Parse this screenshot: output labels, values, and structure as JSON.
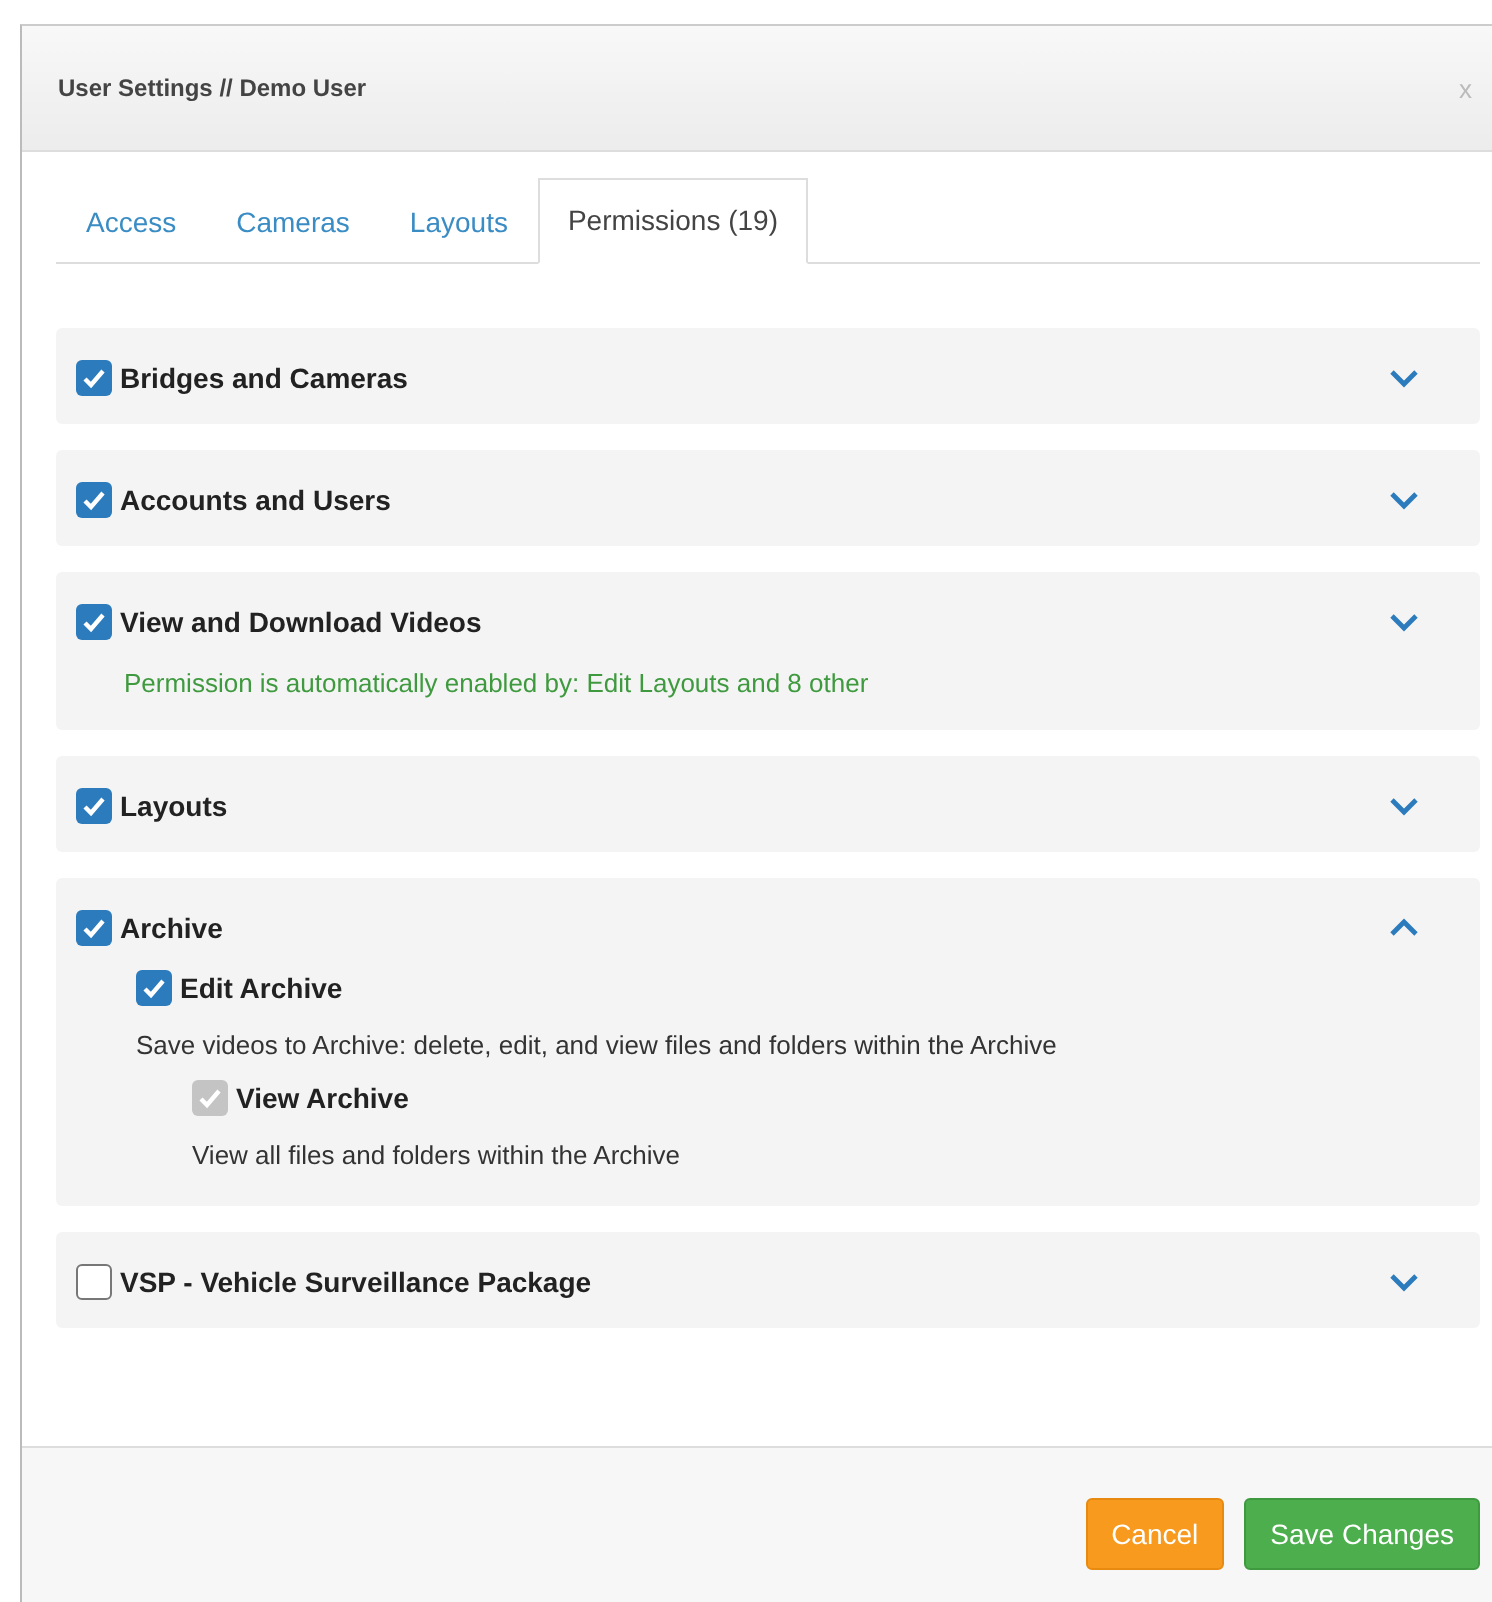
{
  "dialog": {
    "title": "User Settings // Demo User",
    "close": "x"
  },
  "tabs": [
    {
      "label": "Access",
      "selected": false
    },
    {
      "label": "Cameras",
      "selected": false
    },
    {
      "label": "Layouts",
      "selected": false
    },
    {
      "label": "Permissions (19)",
      "selected": true
    }
  ],
  "sections": [
    {
      "label": "Bridges and Cameras",
      "checked": true,
      "expanded": false
    },
    {
      "label": "Accounts and Users",
      "checked": true,
      "expanded": false
    },
    {
      "label": "View and Download Videos",
      "checked": true,
      "expanded": false,
      "note": "Permission is automatically enabled by: Edit Layouts and 8 other"
    },
    {
      "label": "Layouts",
      "checked": true,
      "expanded": false
    },
    {
      "label": "Archive",
      "checked": true,
      "expanded": true,
      "children": [
        {
          "label": "Edit Archive",
          "checked": true,
          "disabled": false,
          "description": "Save videos to Archive: delete, edit, and view files and folders within the Archive",
          "children": [
            {
              "label": "View Archive",
              "checked": true,
              "disabled": true,
              "description": "View all files and folders within the Archive"
            }
          ]
        }
      ]
    },
    {
      "label": "VSP - Vehicle Surveillance Package",
      "checked": false,
      "expanded": false
    }
  ],
  "buttons": [
    {
      "label": "Cancel",
      "kind": "cancel"
    },
    {
      "label": "Save Changes",
      "kind": "primary"
    }
  ]
}
